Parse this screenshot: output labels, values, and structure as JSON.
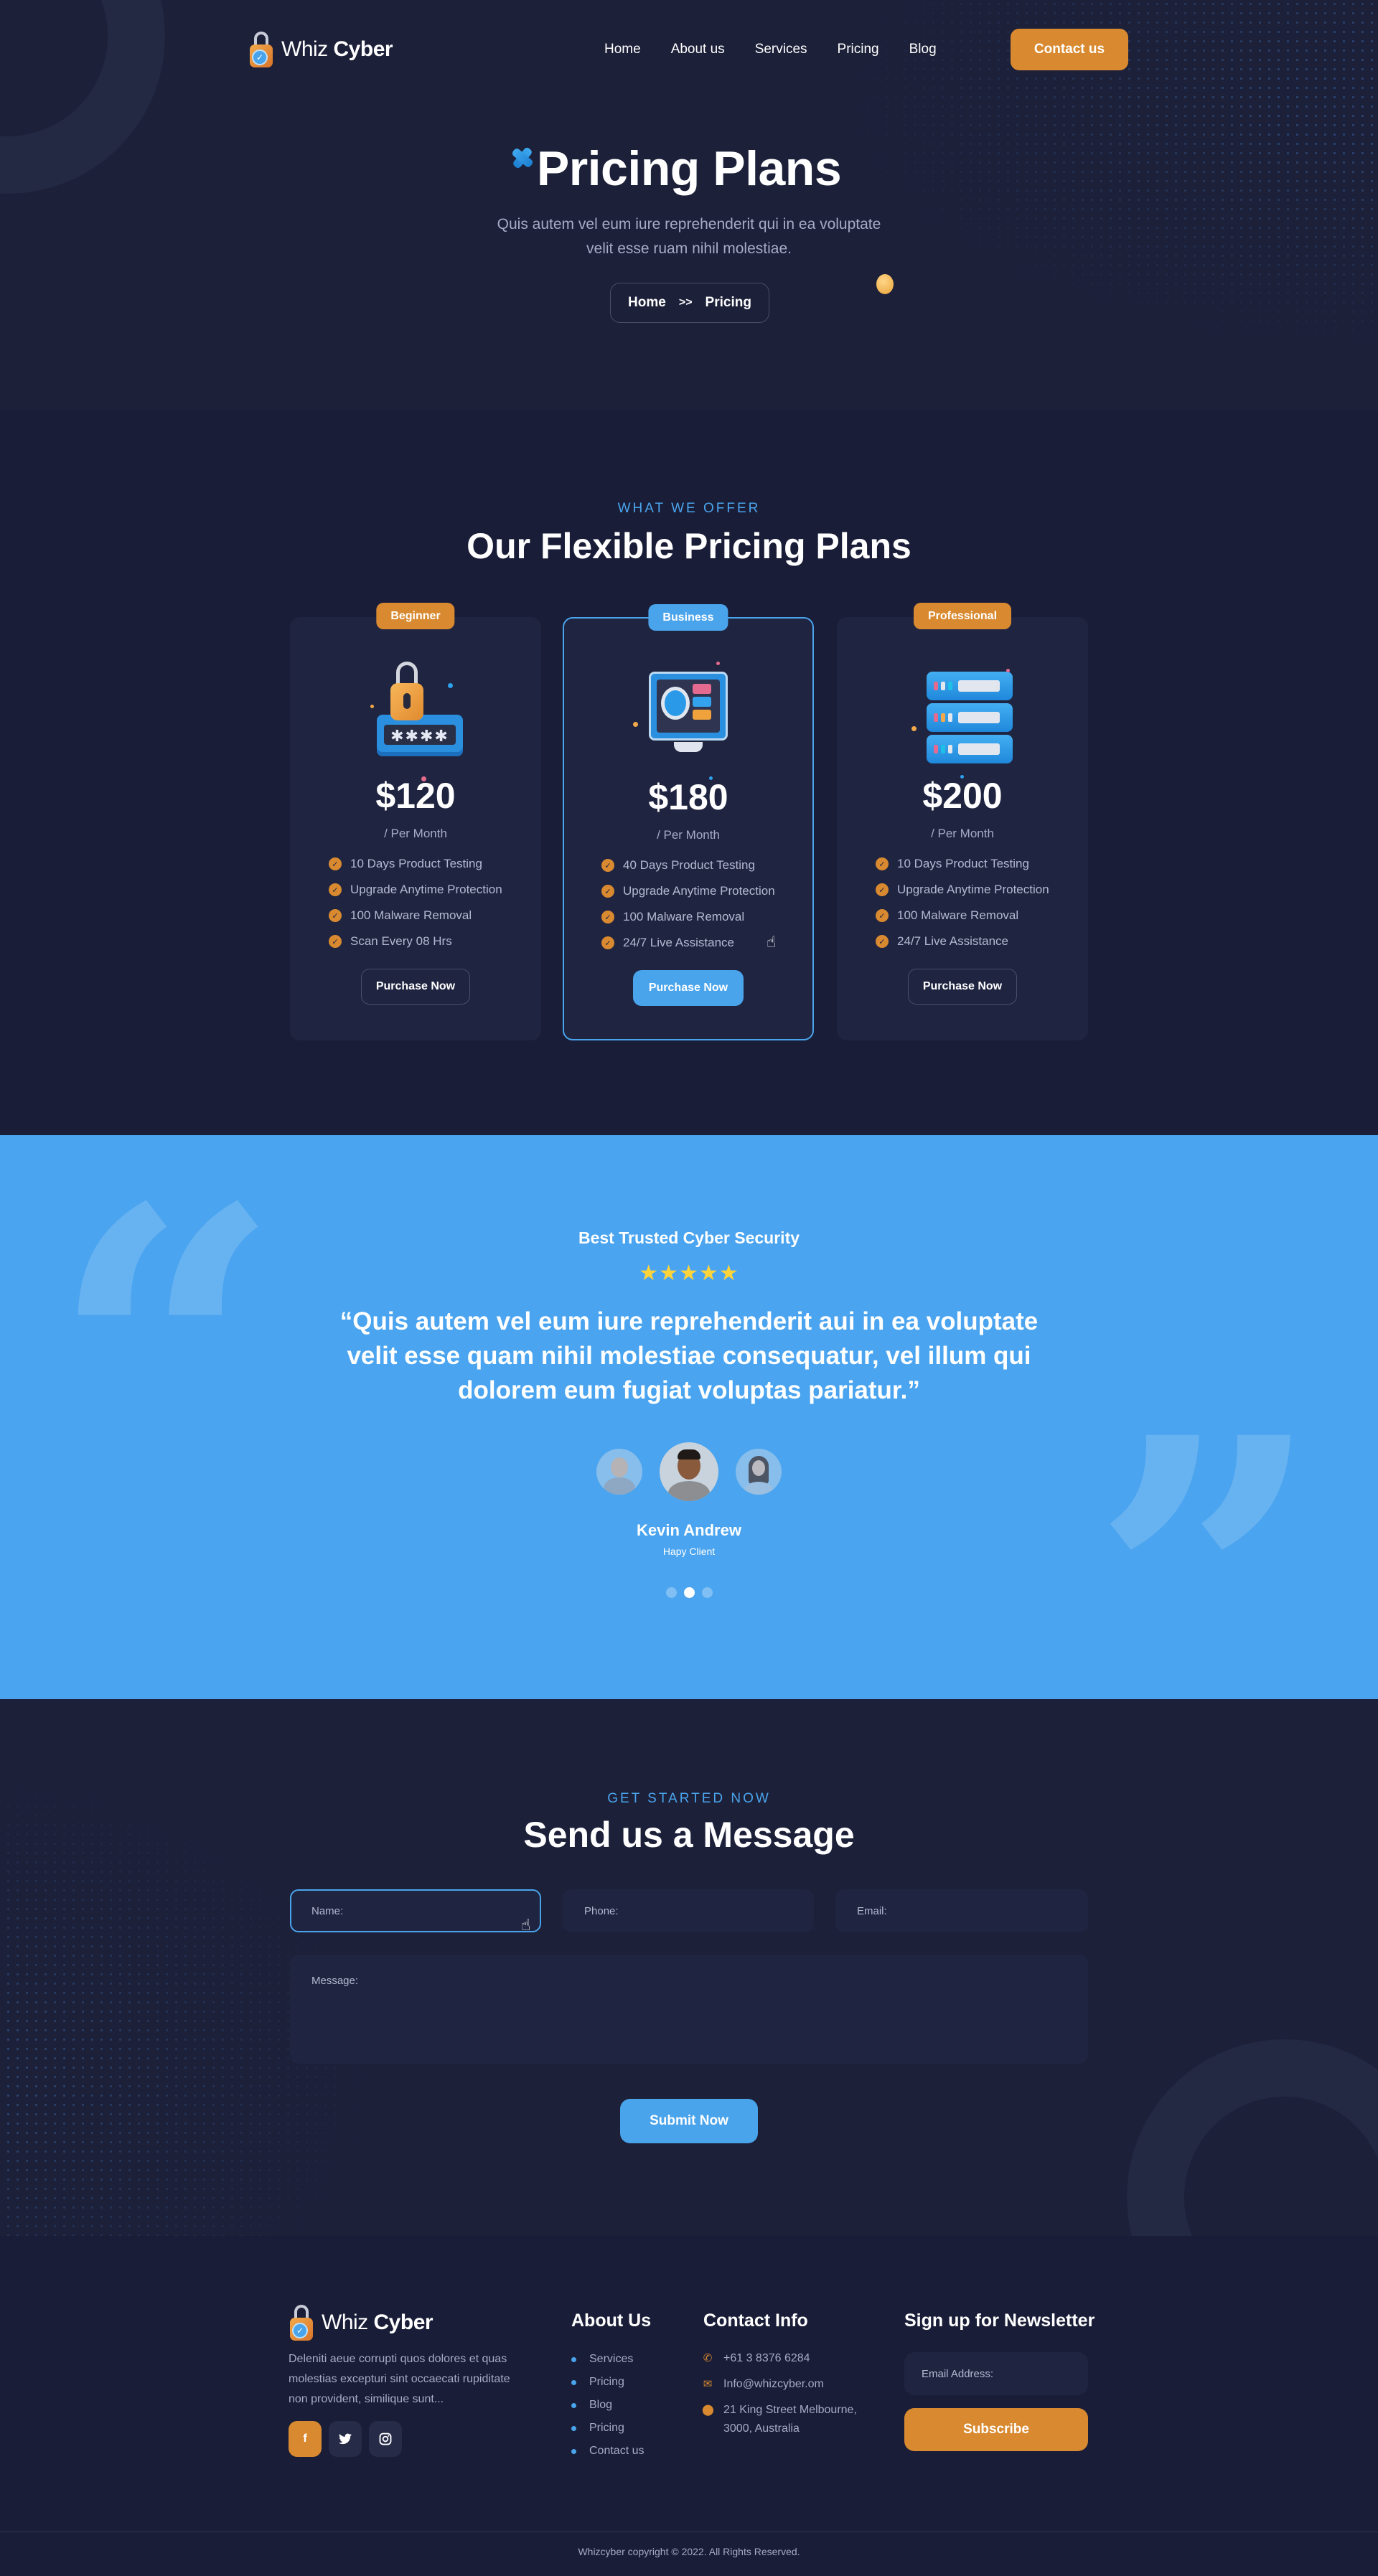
{
  "colors": {
    "page_bg": "#1c2039",
    "accent_orange": "#d98a30",
    "accent_blue": "#4aa4ec",
    "testimonial_bg": "#4aa4ef",
    "card_bg": "#1f2440",
    "muted_text": "#a6abc6",
    "star_yellow": "#ffd43b"
  },
  "nav": {
    "logo": {
      "light": "Whiz",
      "bold": "Cyber",
      "icon": "lock-check-icon"
    },
    "links": [
      {
        "label": "Home"
      },
      {
        "label": "About us"
      },
      {
        "label": "Services"
      },
      {
        "label": "Pricing"
      },
      {
        "label": "Blog"
      }
    ],
    "cta_label": "Contact us"
  },
  "hero": {
    "title": "Pricing Plans",
    "subtitle_line1": "Quis autem vel eum iure reprehenderit qui in ea voluptate",
    "subtitle_line2": "velit esse ruam nihil molestiae.",
    "breadcrumb": {
      "home": "Home",
      "separator": ">>",
      "current": "Pricing"
    }
  },
  "pricing": {
    "eyebrow": "WHAT WE OFFER",
    "title": "Our Flexible Pricing Plans",
    "plans": [
      {
        "tier": "Beginner",
        "illustration": "password-lock-icon",
        "price": "$120",
        "period": "/ Per Month",
        "features": [
          "10 Days Product Testing",
          "Upgrade Anytime Protection",
          "100 Malware Removal",
          "Scan Every 08 Hrs"
        ],
        "button": "Purchase Now",
        "featured": false
      },
      {
        "tier": "Business",
        "illustration": "monitor-eye-icon",
        "price": "$180",
        "period": "/ Per Month",
        "features": [
          "40 Days Product Testing",
          "Upgrade Anytime Protection",
          "100 Malware Removal",
          "24/7 Live Assistance"
        ],
        "button": "Purchase Now",
        "featured": true
      },
      {
        "tier": "Professional",
        "illustration": "server-stack-icon",
        "price": "$200",
        "period": "/ Per Month",
        "features": [
          "10 Days Product Testing",
          "Upgrade Anytime Protection",
          "100 Malware Removal",
          "24/7 Live Assistance"
        ],
        "button": "Purchase Now",
        "featured": false
      }
    ]
  },
  "testimonial": {
    "kicker": "Best Trusted Cyber Security",
    "rating": 5,
    "rating_max": 5,
    "stars": "★★★★★",
    "quote": "“Quis autem vel eum iure reprehenderit aui in ea voluptate velit esse quam nihil molestiae consequatur, vel illum qui dolorem eum fugiat voluptas pariatur.”",
    "name": "Kevin Andrew",
    "role": "Hapy Client",
    "slides": 3,
    "active_slide": 2
  },
  "contact": {
    "eyebrow": "GET STARTED NOW",
    "title": "Send us a Message",
    "fields": {
      "name_placeholder": "Name:",
      "phone_placeholder": "Phone:",
      "email_placeholder": "Email:",
      "message_placeholder": "Message:"
    },
    "submit_label": "Submit Now"
  },
  "footer": {
    "logo": {
      "light": "Whiz",
      "bold": "Cyber"
    },
    "about": "Deleniti aeue corrupti quos dolores et quas molestias excepturi sint occaecati rupiditate non provident, similique sunt...",
    "socials": [
      {
        "name": "facebook",
        "glyph": "f"
      },
      {
        "name": "twitter",
        "glyph": "🐦"
      },
      {
        "name": "instagram",
        "glyph": "◎"
      }
    ],
    "about_title": "About Us",
    "about_links": [
      "Services",
      "Pricing",
      "Blog",
      "Pricing",
      "Contact us"
    ],
    "contact_title": "Contact Info",
    "phone": "+61 3 8376 6284",
    "email": "Info@whizcyber.om",
    "address_line1": "21 King Street Melbourne,",
    "address_line2": "3000, Australia",
    "newsletter_title": "Sign up for Newsletter",
    "newsletter_placeholder": "Email Address:",
    "subscribe_label": "Subscribe",
    "copyright": "Whizcyber copyright © 2022. All Rights Reserved."
  }
}
